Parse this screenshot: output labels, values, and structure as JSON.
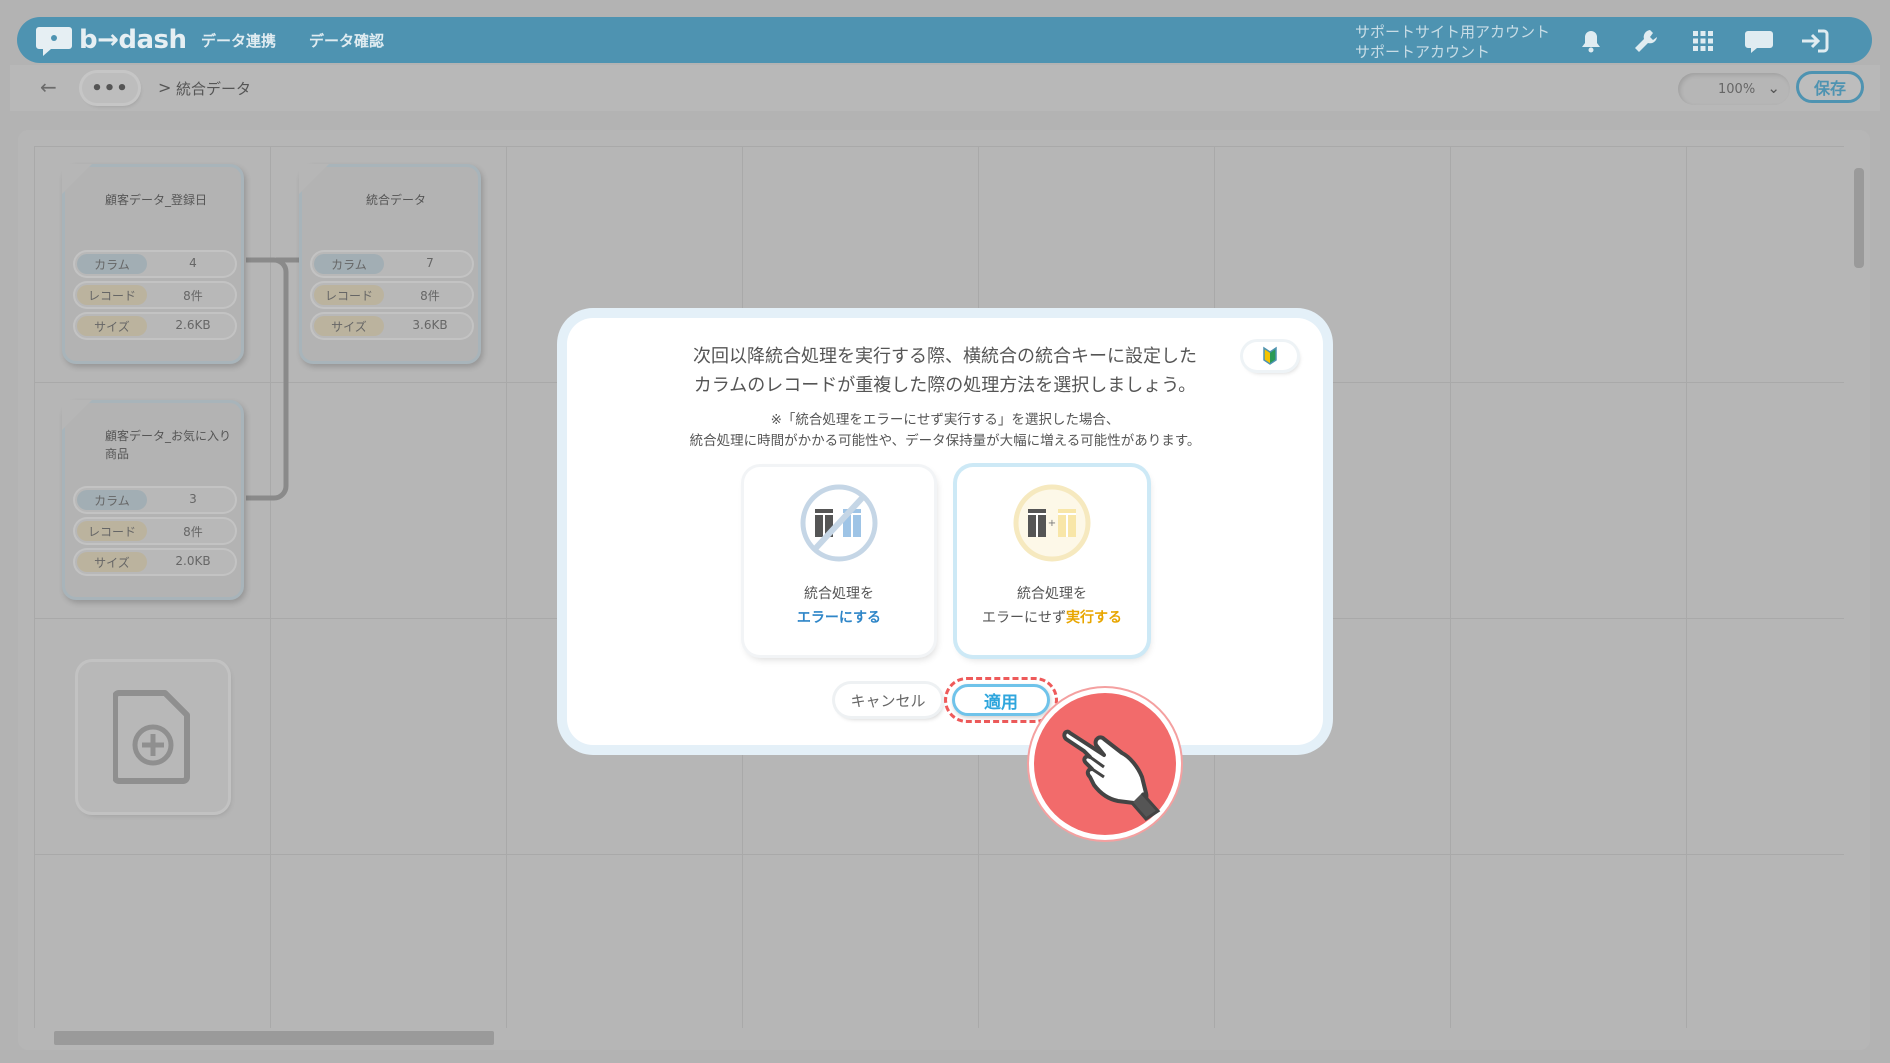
{
  "header": {
    "logo_text": "b→dash",
    "nav": [
      "データ連携",
      "データ確認"
    ],
    "account_line1": "サポートサイト用アカウント",
    "account_line2": "サポートアカウント",
    "icons": [
      "bell-icon",
      "wrench-icon",
      "grid-icon",
      "chat-icon",
      "logout-icon"
    ]
  },
  "breadcrumb": {
    "back_icon": "←",
    "more": "•••",
    "separator": ">",
    "current": "統合データ"
  },
  "toolbar": {
    "zoom": "100%",
    "save_label": "保存"
  },
  "cards": [
    {
      "title": "顧客データ_登録日",
      "columns_label": "カラム",
      "columns": "4",
      "records_label": "レコード",
      "records": "8件",
      "size_label": "サイズ",
      "size": "2.6KB"
    },
    {
      "title": "統合データ",
      "columns_label": "カラム",
      "columns": "7",
      "records_label": "レコード",
      "records": "8件",
      "size_label": "サイズ",
      "size": "3.6KB"
    },
    {
      "title": "顧客データ_お気に入り商品",
      "columns_label": "カラム",
      "columns": "3",
      "records_label": "レコード",
      "records": "8件",
      "size_label": "サイズ",
      "size": "2.0KB"
    }
  ],
  "modal": {
    "title": "次回以降統合処理を実行する際、横統合の統合キーに設定した\nカラムのレコードが重複した際の処理方法を選択しましょう。",
    "note": "※「統合処理をエラーにせず実行する」を選択した場合、\n統合処理に時間がかかる可能性や、データ保持量が大幅に増える可能性があります。",
    "option_error": {
      "line1": "統合処理を",
      "highlight": "エラーにする"
    },
    "option_execute": {
      "line1": "統合処理を",
      "prefix": "エラーにせず",
      "highlight": "実行する"
    },
    "cancel_label": "キャンセル",
    "apply_label": "適用"
  },
  "colors": {
    "header": "#4e93b1",
    "accent_blue": "#2f86c8",
    "accent_gold": "#e8a600",
    "apply": "#2fa6dd",
    "highlight_red": "#ee5a5a"
  }
}
